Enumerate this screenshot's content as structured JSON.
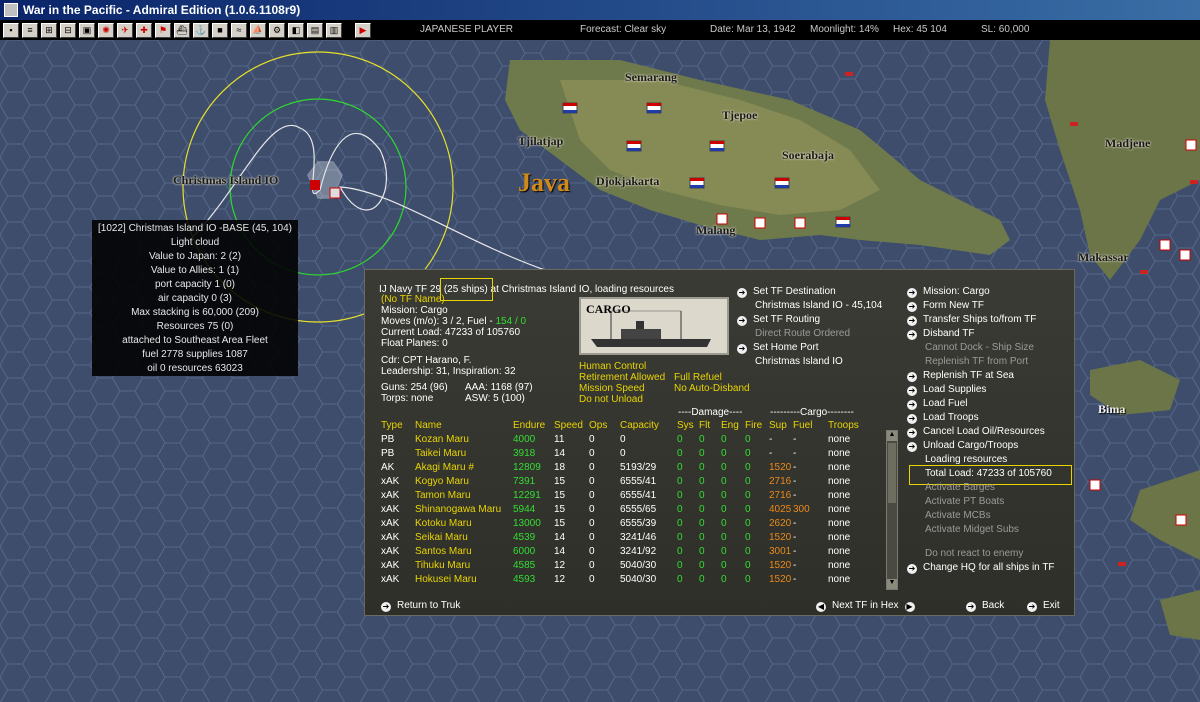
{
  "window": {
    "title": "War in the Pacific - Admiral Edition (1.0.6.1108r9)"
  },
  "toolbar": {
    "player": "JAPANESE PLAYER",
    "forecast": "Forecast: Clear sky",
    "date": "Date: Mar 13, 1942",
    "moonlight": "Moonlight: 14%",
    "hex": "Hex: 45 104",
    "sl": "SL: 60,000"
  },
  "map": {
    "labels": {
      "semarang": "Semarang",
      "tjepoe": "Tjepoe",
      "tjilatjap": "Tjilatjap",
      "soerabaja": "Soerabaja",
      "christmas": "Christmas Island IO",
      "java": "Java",
      "djokjakarta": "Djokjakarta",
      "malang": "Malang",
      "madjene": "Madjene",
      "makassar": "Makassar",
      "bima": "Bima"
    }
  },
  "base_popup": {
    "lines": [
      "[1022] Christmas Island IO  -BASE  (45, 104)",
      "Light cloud",
      "Value to Japan: 2 (2)",
      "Value to Allies: 1 (1)",
      "port capacity 1 (0)",
      "air capacity 0 (3)",
      "Max stacking is 60,000  (209)",
      "Resources  75 (0)",
      "attached to Southeast Area Fleet",
      "fuel 2778  supplies 1087",
      "oil 0  resources 63023"
    ]
  },
  "tf_panel": {
    "header_pre": "IJ Navy TF 29",
    "header_box": "(25 ships)",
    "header_post": "at Christmas Island IO, loading resources",
    "tf_name": "(No TF Name)",
    "mission": "Mission: Cargo",
    "moves_pre": "Moves (m/o): 3 / 2, Fuel - ",
    "moves_fuel": "154 / 0",
    "current_load": "Current Load: 47233 of 105760",
    "float_planes": "Float Planes: 0",
    "cdr": "Cdr: CPT Harano, F.",
    "leadership": "Leadership: 31, Inspiration: 32",
    "guns": "Guns: 254 (96)",
    "aaa": "AAA: 1168 (97)",
    "torps": "Torps: none",
    "asw": "ASW: 5 (100)",
    "cargo_img_label": "CARGO",
    "human_control": "Human Control",
    "retirement": "Retirement Allowed",
    "full_refuel": "Full Refuel",
    "mission_speed": "Mission Speed",
    "no_auto_disband": "No Auto-Disband",
    "do_not_unload": "Do not Unload",
    "set_dest": "Set TF Destination",
    "dest_value": "Christmas Island IO - 45,104",
    "set_routing": "Set TF Routing",
    "direct_route": "Direct Route Ordered",
    "set_home": "Set Home Port",
    "home_value": "Christmas Island IO",
    "damage_header": "----Damage----",
    "cargo_header": "---------Cargo--------",
    "columns": [
      "Type",
      "Name",
      "Endure",
      "Speed",
      "Ops",
      "Capacity",
      "Sys",
      "Flt",
      "Eng",
      "Fire",
      "Sup",
      "Fuel",
      "Troops"
    ],
    "ships": [
      {
        "type": "PB",
        "name": "Kozan Maru",
        "endure": "4000",
        "speed": "11",
        "ops": "0",
        "capacity": "0",
        "sys": "0",
        "flt": "0",
        "eng": "0",
        "fire": "0",
        "sup": "-",
        "fuel": "-",
        "troops": "none"
      },
      {
        "type": "PB",
        "name": "Taikei Maru",
        "endure": "3918",
        "speed": "14",
        "ops": "0",
        "capacity": "0",
        "sys": "0",
        "flt": "0",
        "eng": "0",
        "fire": "0",
        "sup": "-",
        "fuel": "-",
        "troops": "none"
      },
      {
        "type": "AK",
        "name": "Akagi Maru #",
        "endure": "12809",
        "speed": "18",
        "ops": "0",
        "capacity": "5193/29",
        "sys": "0",
        "flt": "0",
        "eng": "0",
        "fire": "0",
        "sup": "1520",
        "fuel": "-",
        "troops": "none"
      },
      {
        "type": "xAK",
        "name": "Kogyo Maru",
        "endure": "7391",
        "speed": "15",
        "ops": "0",
        "capacity": "6555/41",
        "sys": "0",
        "flt": "0",
        "eng": "0",
        "fire": "0",
        "sup": "2716",
        "fuel": "-",
        "troops": "none"
      },
      {
        "type": "xAK",
        "name": "Tamon Maru",
        "endure": "12291",
        "speed": "15",
        "ops": "0",
        "capacity": "6555/41",
        "sys": "0",
        "flt": "0",
        "eng": "0",
        "fire": "0",
        "sup": "2716",
        "fuel": "-",
        "troops": "none"
      },
      {
        "type": "xAK",
        "name": "Shinanogawa Maru",
        "endure": "5944",
        "speed": "15",
        "ops": "0",
        "capacity": "6555/65",
        "sys": "0",
        "flt": "0",
        "eng": "0",
        "fire": "0",
        "sup": "4025",
        "fuel": "300",
        "troops": "none"
      },
      {
        "type": "xAK",
        "name": "Kotoku Maru",
        "endure": "13000",
        "speed": "15",
        "ops": "0",
        "capacity": "6555/39",
        "sys": "0",
        "flt": "0",
        "eng": "0",
        "fire": "0",
        "sup": "2620",
        "fuel": "-",
        "troops": "none"
      },
      {
        "type": "xAK",
        "name": "Seikai Maru",
        "endure": "4539",
        "speed": "14",
        "ops": "0",
        "capacity": "3241/46",
        "sys": "0",
        "flt": "0",
        "eng": "0",
        "fire": "0",
        "sup": "1520",
        "fuel": "-",
        "troops": "none"
      },
      {
        "type": "xAK",
        "name": "Santos Maru",
        "endure": "6000",
        "speed": "14",
        "ops": "0",
        "capacity": "3241/92",
        "sys": "0",
        "flt": "0",
        "eng": "0",
        "fire": "0",
        "sup": "3001",
        "fuel": "-",
        "troops": "none"
      },
      {
        "type": "xAK",
        "name": "Tihuku Maru",
        "endure": "4585",
        "speed": "12",
        "ops": "0",
        "capacity": "5040/30",
        "sys": "0",
        "flt": "0",
        "eng": "0",
        "fire": "0",
        "sup": "1520",
        "fuel": "-",
        "troops": "none"
      },
      {
        "type": "xAK",
        "name": "Hokusei Maru",
        "endure": "4593",
        "speed": "12",
        "ops": "0",
        "capacity": "5040/30",
        "sys": "0",
        "flt": "0",
        "eng": "0",
        "fire": "0",
        "sup": "1520",
        "fuel": "-",
        "troops": "none"
      }
    ],
    "commands": {
      "mission": "Mission: Cargo",
      "form_new": "Form New TF",
      "transfer": "Transfer Ships to/from TF",
      "disband": "Disband TF",
      "cannot_dock": "Cannot Dock - Ship Size",
      "replenish_port": "Replenish TF from Port",
      "replenish_sea": "Replenish TF at Sea",
      "load_supplies": "Load Supplies",
      "load_fuel": "Load Fuel",
      "load_troops": "Load Troops",
      "cancel_load": "Cancel Load Oil/Resources",
      "unload": "Unload Cargo/Troops",
      "loading": "Loading resources",
      "total_load": "Total Load: 47233 of 105760",
      "barges": "Activate Barges",
      "pt_boats": "Activate PT Boats",
      "mcbs": "Activate MCBs",
      "midget": "Activate Midget Subs",
      "no_react": "Do not react to enemy",
      "change_hq": "Change HQ for all ships in TF"
    },
    "footer": {
      "return": "Return to Truk",
      "next_tf": "Next TF in Hex",
      "back": "Back",
      "exit": "Exit"
    }
  }
}
